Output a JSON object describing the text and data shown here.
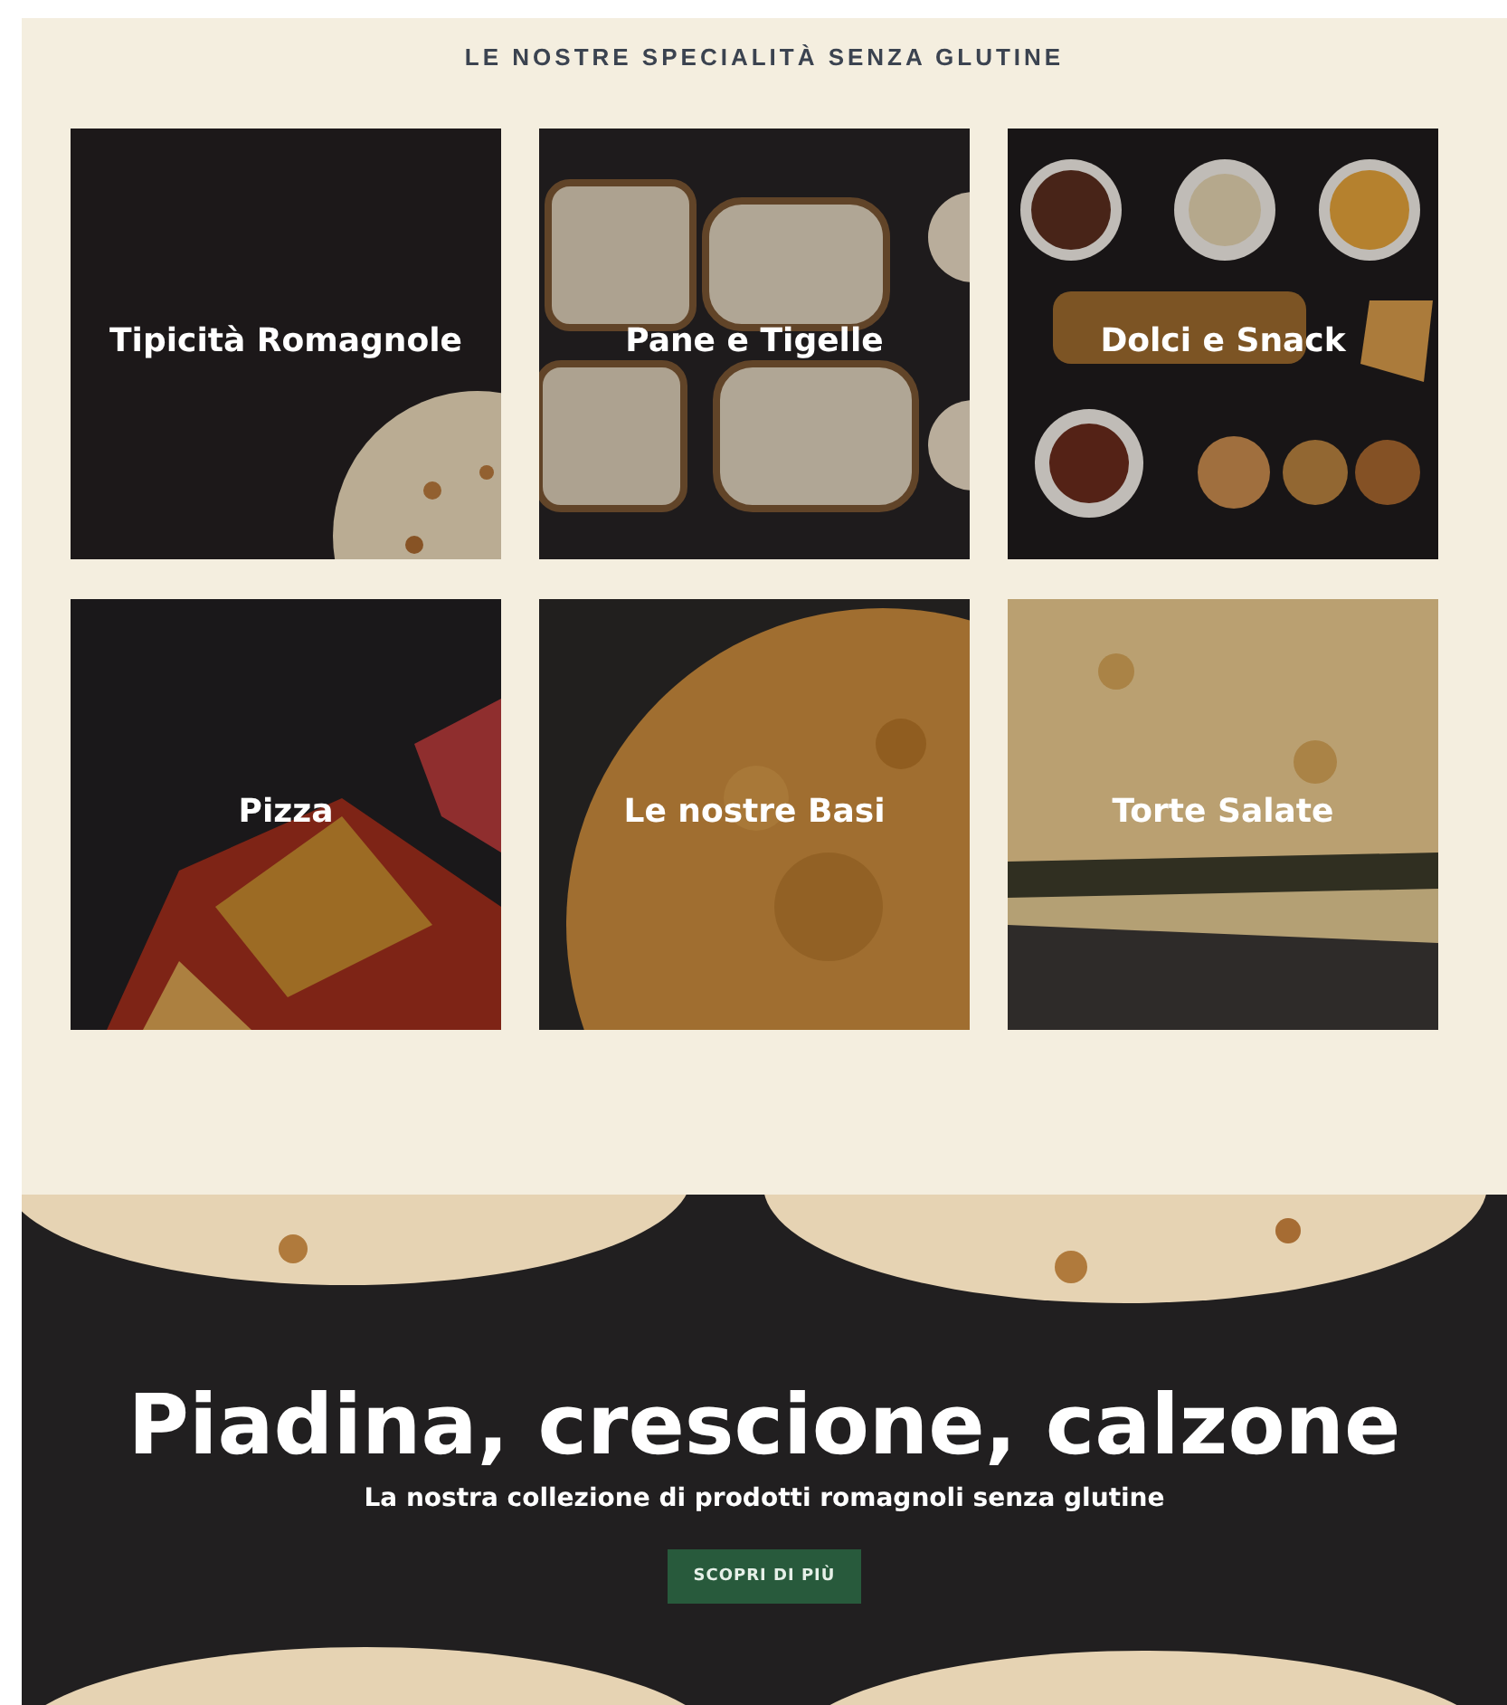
{
  "section_title": "LE NOSTRE SPECIALITÀ SENZA GLUTINE",
  "categories": [
    {
      "label": "Tipicità Romagnole",
      "kind": "picture"
    },
    {
      "label": "Pane e Tigelle",
      "kind": "picture"
    },
    {
      "label": "Dolci e Snack",
      "kind": "picture"
    },
    {
      "label": "Pizza",
      "kind": "picture"
    },
    {
      "label": "Le nostre Basi",
      "kind": "picture"
    },
    {
      "label": "Torte Salate",
      "kind": "picture"
    }
  ],
  "hero": {
    "title": "Piadina, crescione, calzone",
    "subtitle": "La nostra collezione di prodotti romagnoli senza glutine",
    "button": "SCOPRI DI PIÙ"
  }
}
